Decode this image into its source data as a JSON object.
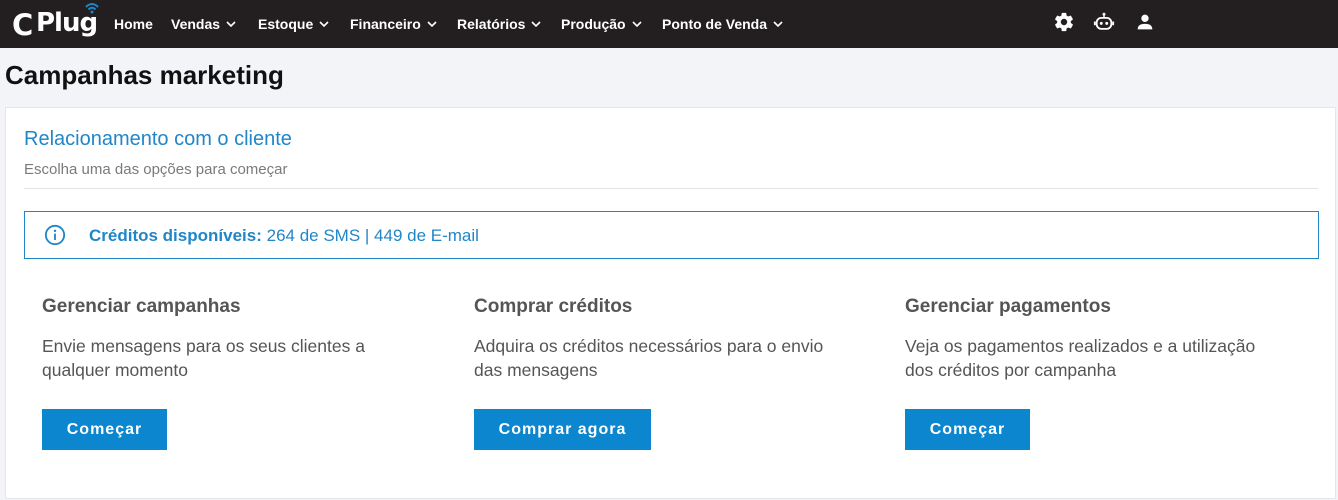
{
  "app": {
    "logo_c": "C",
    "logo_plug": "Plug"
  },
  "nav": {
    "home": "Home",
    "vendas": "Vendas",
    "estoque": "Estoque",
    "financeiro": "Financeiro",
    "relatorios": "Relatórios",
    "producao": "Produção",
    "ponto_venda": "Ponto de Venda"
  },
  "header_icons": [
    "gear-icon",
    "robot-icon",
    "user-icon"
  ],
  "page": {
    "title": "Campanhas marketing"
  },
  "card": {
    "title": "Relacionamento com o cliente",
    "subtitle": "Escolha uma das opções para começar",
    "credits_label": "Créditos disponíveis:",
    "credits_value": "264 de SMS | 449 de E-mail"
  },
  "options": [
    {
      "title": "Gerenciar campanhas",
      "description": "Envie mensagens para os seus clientes a qualquer momento",
      "button": "Começar"
    },
    {
      "title": "Comprar créditos",
      "description": "Adquira os créditos necessários para o envio das mensagens",
      "button": "Comprar agora"
    },
    {
      "title": "Gerenciar pagamentos",
      "description": "Veja os pagamentos realizados e a utilização dos créditos por campanha",
      "button": "Começar"
    }
  ],
  "colors": {
    "topbar": "#231f20",
    "accent": "#1f86c8",
    "button": "#0b86cf"
  }
}
